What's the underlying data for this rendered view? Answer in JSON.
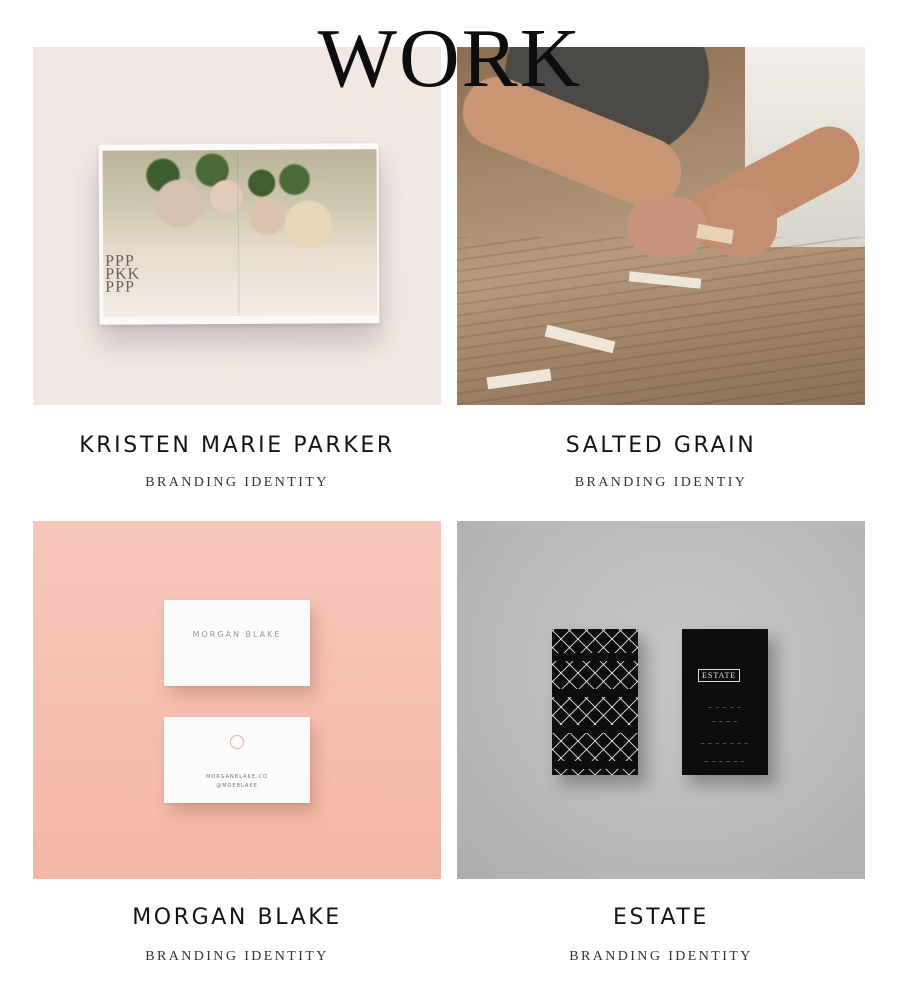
{
  "header": {
    "title": "WORK"
  },
  "projects": [
    {
      "name": "KRISTEN MARIE PARKER",
      "category": "BRANDING IDENTITY",
      "image_label": "P P P P K K P P P",
      "image": "magazine-spread-mockup"
    },
    {
      "name": "SALTED GRAIN",
      "category": "BRANDING IDENTIY",
      "image": "woodworker-carving-table"
    },
    {
      "name": "MORGAN BLAKE",
      "category": "BRANDING IDENTITY",
      "image": "business-cards-pink",
      "card_front": "MORGAN BLAKE",
      "card_back_line1": "MORGANBLAKE.CO",
      "card_back_line2": "@MOEBLAKE"
    },
    {
      "name": "ESTATE",
      "category": "BRANDING IDENTITY",
      "image": "business-cards-black",
      "card_brand": "ESTATE"
    }
  ],
  "colors": {
    "tile_1_bg": "#f1e8e4",
    "tile_3_bg": "#f3b7a6",
    "tile_4_bg": "#b9b9b9",
    "text": "#151515"
  }
}
